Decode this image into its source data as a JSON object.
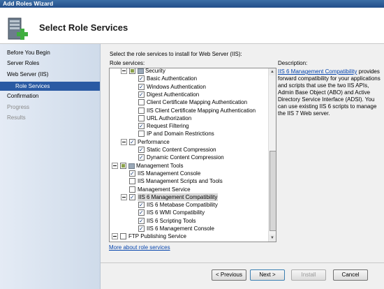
{
  "window": {
    "title": "Add Roles Wizard"
  },
  "header": {
    "title": "Select Role Services"
  },
  "nav": {
    "items": [
      {
        "label": "Before You Begin",
        "state": "normal"
      },
      {
        "label": "Server Roles",
        "state": "normal"
      },
      {
        "label": "Web Server (IIS)",
        "state": "normal"
      },
      {
        "label": "Role Services",
        "state": "selected"
      },
      {
        "label": "Confirmation",
        "state": "normal"
      },
      {
        "label": "Progress",
        "state": "disabled"
      },
      {
        "label": "Results",
        "state": "disabled"
      }
    ]
  },
  "main": {
    "intro": "Select the role services to install for Web Server (IIS):",
    "role_services_label": "Role services:",
    "more_link": "More about role services",
    "tree": [
      {
        "label": "Security",
        "level": 1,
        "expander": true,
        "check": "partial",
        "folder": true
      },
      {
        "label": "Basic Authentication",
        "level": 2,
        "check": "checked"
      },
      {
        "label": "Windows Authentication",
        "level": 2,
        "check": "checked"
      },
      {
        "label": "Digest Authentication",
        "level": 2,
        "check": "checked"
      },
      {
        "label": "Client Certificate Mapping Authentication",
        "level": 2,
        "check": "unchecked"
      },
      {
        "label": "IIS Client Certificate Mapping Authentication",
        "level": 2,
        "check": "unchecked"
      },
      {
        "label": "URL Authorization",
        "level": 2,
        "check": "unchecked"
      },
      {
        "label": "Request Filtering",
        "level": 2,
        "check": "checked"
      },
      {
        "label": "IP and Domain Restrictions",
        "level": 2,
        "check": "unchecked"
      },
      {
        "label": "Performance",
        "level": 1,
        "expander": true,
        "check": "checked"
      },
      {
        "label": "Static Content Compression",
        "level": 2,
        "check": "checked"
      },
      {
        "label": "Dynamic Content Compression",
        "level": 2,
        "check": "checked"
      },
      {
        "label": "Management Tools",
        "level": 0,
        "expander": true,
        "check": "partial",
        "folder": true
      },
      {
        "label": "IIS Management Console",
        "level": 1,
        "check": "checked"
      },
      {
        "label": "IIS Management Scripts and Tools",
        "level": 1,
        "check": "unchecked"
      },
      {
        "label": "Management Service",
        "level": 1,
        "check": "unchecked"
      },
      {
        "label": "IIS 6 Management Compatibility",
        "level": 1,
        "expander": true,
        "check": "checked",
        "highlight": true
      },
      {
        "label": "IIS 6 Metabase Compatibility",
        "level": 2,
        "check": "checked"
      },
      {
        "label": "IIS 6 WMI Compatibility",
        "level": 2,
        "check": "checked"
      },
      {
        "label": "IIS 6 Scripting Tools",
        "level": 2,
        "check": "checked"
      },
      {
        "label": "IIS 6 Management Console",
        "level": 2,
        "check": "checked"
      },
      {
        "label": "FTP Publishing Service",
        "level": 0,
        "expander": true,
        "check": "unchecked"
      }
    ],
    "description": {
      "heading": "Description:",
      "link": "IIS 6 Management Compatibility",
      "text": "provides forward compatibility for your applications and scripts that use the two IIS APIs, Admin Base Object (ABO) and Active Directory Service Interface (ADSI). You can use existing IIS 6 scripts to manage the IIS 7 Web server."
    }
  },
  "buttons": {
    "previous": "< Previous",
    "next": "Next >",
    "install": "Install",
    "cancel": "Cancel"
  }
}
